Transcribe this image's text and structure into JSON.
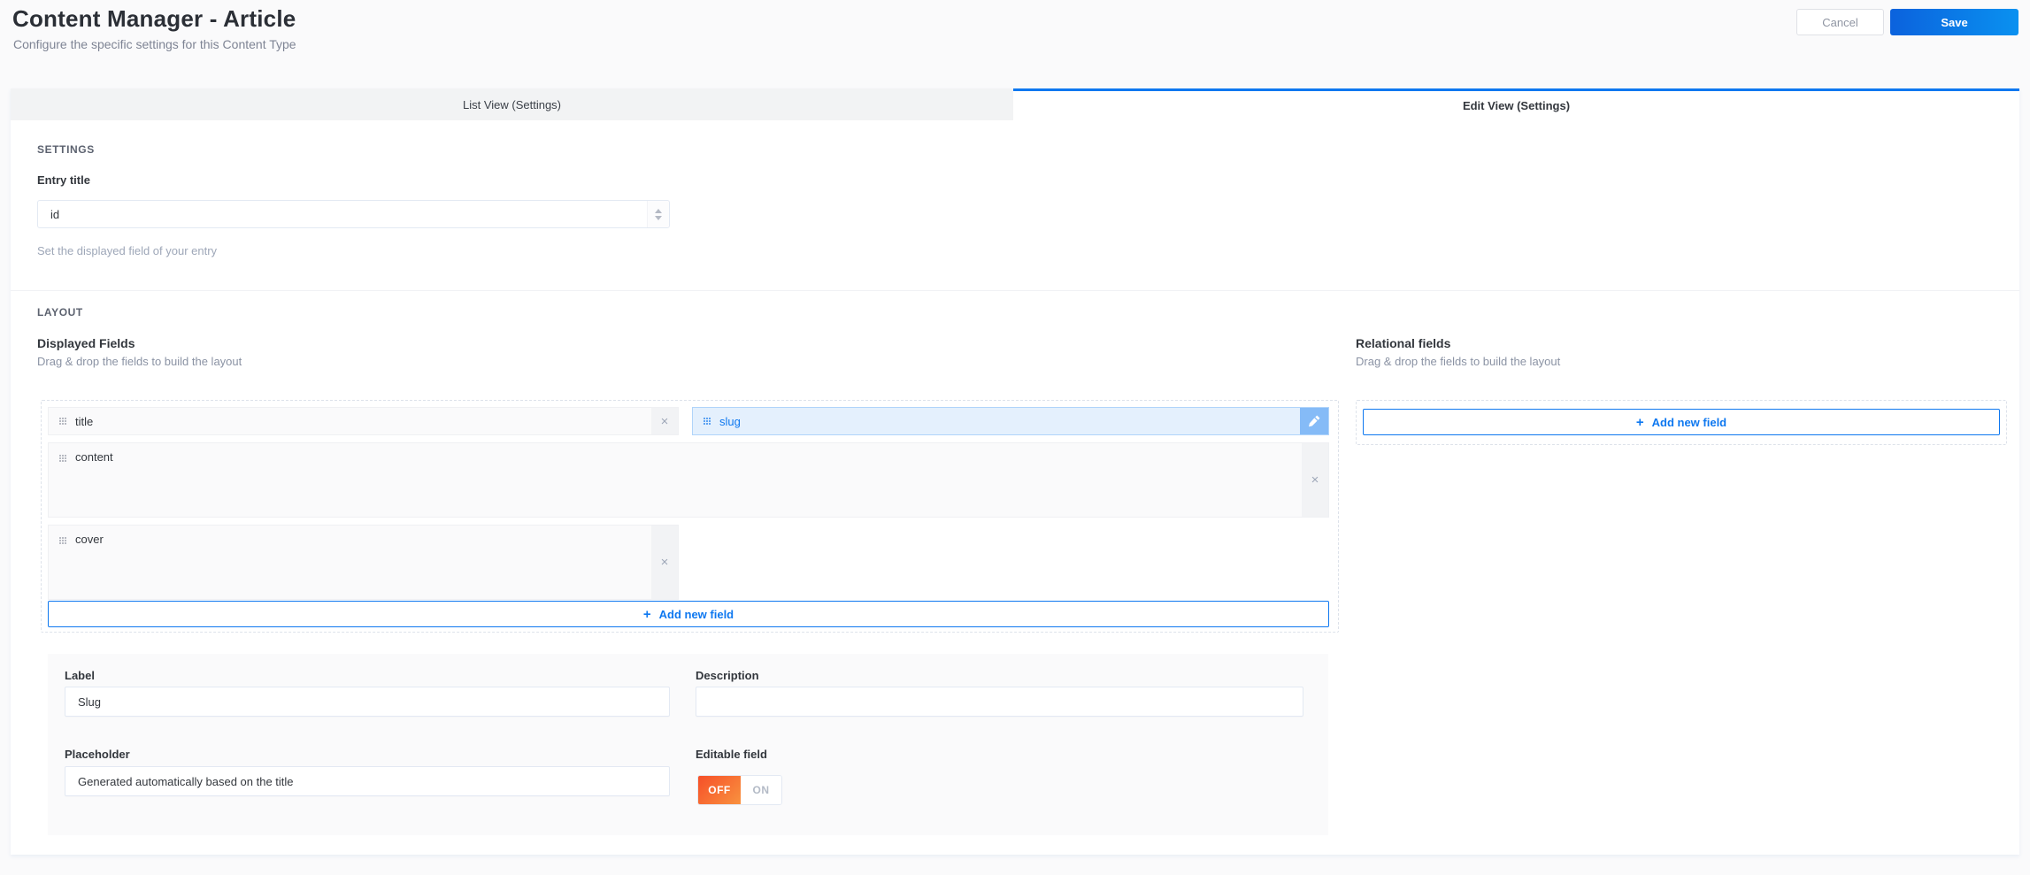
{
  "header": {
    "title": "Content Manager - Article",
    "subtitle": "Configure the specific settings for this Content Type",
    "cancel_label": "Cancel",
    "save_label": "Save"
  },
  "tabs": [
    {
      "label": "List View (Settings)",
      "active": false
    },
    {
      "label": "Edit View (Settings)",
      "active": true
    }
  ],
  "settings": {
    "section_title": "SETTINGS",
    "entry_title_label": "Entry title",
    "entry_title_value": "id",
    "entry_title_help": "Set the displayed field of your entry"
  },
  "layout": {
    "section_title": "LAYOUT",
    "displayed_fields": {
      "title": "Displayed Fields",
      "subtitle": "Drag & drop the fields to build the layout",
      "fields": [
        {
          "name": "title",
          "size": "small",
          "state": "normal"
        },
        {
          "name": "slug",
          "size": "small",
          "state": "selected"
        },
        {
          "name": "content",
          "size": "large-full",
          "state": "normal"
        },
        {
          "name": "cover",
          "size": "large-half",
          "state": "normal"
        }
      ],
      "add_button_label": "Add new field"
    },
    "relational_fields": {
      "title": "Relational fields",
      "subtitle": "Drag & drop the fields to build the layout",
      "add_button_label": "Add new field"
    }
  },
  "field_form": {
    "label_label": "Label",
    "label_value": "Slug",
    "description_label": "Description",
    "description_value": "",
    "placeholder_label": "Placeholder",
    "placeholder_value": "Generated automatically based on the title",
    "editable_label": "Editable field",
    "toggle_off_label": "OFF",
    "toggle_on_label": "ON",
    "toggle_value": "OFF"
  },
  "icons": {
    "plus_glyph": "+",
    "close_glyph": "×"
  },
  "colors": {
    "primary_blue": "#0e78f0",
    "save_gradient": [
      "#0b62dd",
      "#0a91f0"
    ],
    "toggle_off_gradient": [
      "#f64f28",
      "#f9923f"
    ],
    "selected_field_bg": "#e4f0fd",
    "selected_field_border": "#b0d4fa",
    "edit_strip_bg": "#85bbf7",
    "field_bg": "#fafafb",
    "panel_bg": "#fafafb",
    "inactive_tab_bg": "#f2f3f4"
  }
}
